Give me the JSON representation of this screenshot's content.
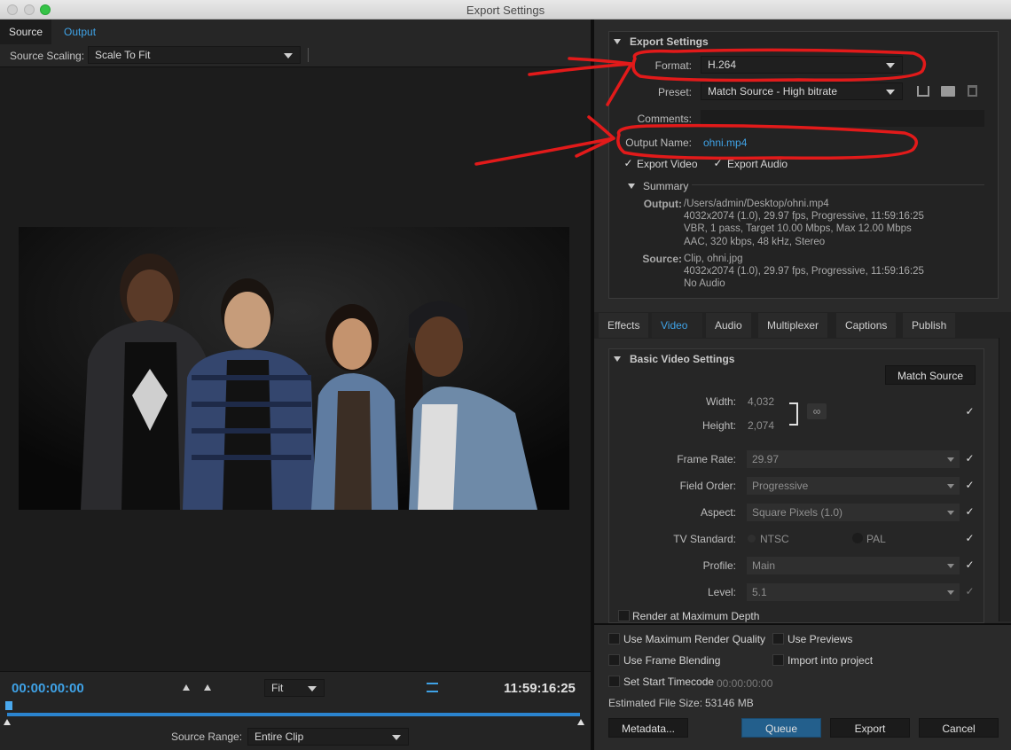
{
  "window": {
    "title": "Export Settings"
  },
  "left": {
    "tabs": [
      "Source",
      "Output"
    ],
    "source_scaling_label": "Source Scaling:",
    "source_scaling_value": "Scale To Fit",
    "timeline": {
      "start_time": "00:00:00:00",
      "end_time": "11:59:16:25",
      "zoom_value": "Fit",
      "source_range_label": "Source Range:",
      "source_range_value": "Entire Clip"
    }
  },
  "export_settings": {
    "header": "Export Settings",
    "format_label": "Format:",
    "format_value": "H.264",
    "preset_label": "Preset:",
    "preset_value": "Match Source - High bitrate",
    "comments_label": "Comments:",
    "comments_value": "",
    "output_name_label": "Output Name:",
    "output_name_value": "ohni.mp4",
    "export_video_label": "Export Video",
    "export_audio_label": "Export Audio",
    "summary": {
      "header": "Summary",
      "output_label": "Output:",
      "output_lines": [
        "/Users/admin/Desktop/ohni.mp4",
        "4032x2074 (1.0), 29.97 fps, Progressive, 11:59:16:25",
        "VBR, 1 pass, Target 10.00 Mbps, Max 12.00 Mbps",
        "AAC, 320 kbps, 48 kHz, Stereo"
      ],
      "source_label": "Source:",
      "source_lines": [
        "Clip, ohni.jpg",
        "4032x2074 (1.0), 29.97 fps, Progressive, 11:59:16:25",
        "No Audio"
      ]
    }
  },
  "settings_tabs": [
    "Effects",
    "Video",
    "Audio",
    "Multiplexer",
    "Captions",
    "Publish"
  ],
  "basic_video": {
    "header": "Basic Video Settings",
    "match_source_label": "Match Source",
    "width_label": "Width:",
    "width_value": "4,032",
    "height_label": "Height:",
    "height_value": "2,074",
    "frame_rate_label": "Frame Rate:",
    "frame_rate_value": "29.97",
    "field_order_label": "Field Order:",
    "field_order_value": "Progressive",
    "aspect_label": "Aspect:",
    "aspect_value": "Square Pixels (1.0)",
    "tv_standard_label": "TV Standard:",
    "tv_ntsc": "NTSC",
    "tv_pal": "PAL",
    "profile_label": "Profile:",
    "profile_value": "Main",
    "level_label": "Level:",
    "level_value": "5.1",
    "render_max_depth": "Render at Maximum Depth"
  },
  "options": {
    "use_max_render": "Use Maximum Render Quality",
    "use_previews": "Use Previews",
    "use_frame_blending": "Use Frame Blending",
    "import_into_project": "Import into project",
    "set_start_timecode": "Set Start Timecode",
    "start_timecode_value": "00:00:00:00",
    "estimated_size_label": "Estimated File Size:",
    "estimated_size_value": "53146 MB"
  },
  "buttons": {
    "metadata": "Metadata...",
    "queue": "Queue",
    "export": "Export",
    "cancel": "Cancel"
  },
  "colors": {
    "accent_blue": "#3fa2e6",
    "annotation_red": "#e21a1a",
    "queue_button": "#235f8c"
  }
}
